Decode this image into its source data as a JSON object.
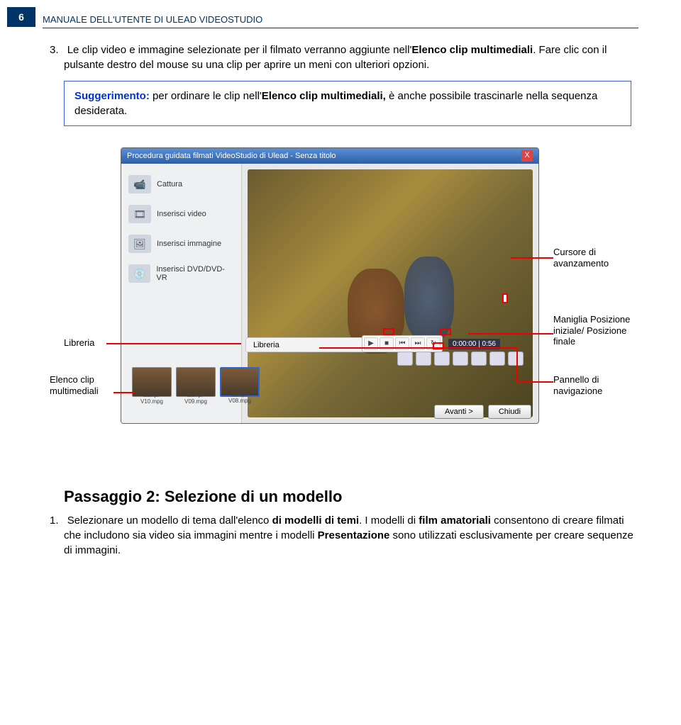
{
  "page_number": "6",
  "header_title": "MANUALE DELL'UTENTE DI ULEAD VIDEOSTUDIO",
  "para3_num": "3.",
  "para3": "Le clip video e immagine selezionate per il filmato verranno aggiunte nell'",
  "para3_bold": "Elenco clip multimediali",
  "para3_tail": ". Fare clic con il pulsante destro del mouse su una clip per aprire un meni con ulteriori opzioni.",
  "tip_label": "Suggerimento:",
  "tip_text": " per ordinare le clip nell'",
  "tip_bold": "Elenco clip multimediali,",
  "tip_tail": " è anche possibile trascinarle nella sequenza desiderata.",
  "window": {
    "title": "Procedura guidata filmati VideoStudio di Ulead - Senza titolo",
    "close": "X",
    "side": {
      "cattura": "Cattura",
      "video": "Inserisci video",
      "immagine": "Inserisci immagine",
      "dvd": "Inserisci DVD/DVD-VR"
    },
    "lib_label": "Libreria",
    "timecode": "0:00:00 | 0:56",
    "thumbs": [
      "Sampl-V10.mpg",
      "Sampl-V09.mpg",
      "Sampl-V08.mpg"
    ],
    "btn_avanti": "Avanti >",
    "btn_chiudi": "Chiudi"
  },
  "callouts": {
    "cursore": "Cursore di avanzamento",
    "libreria": "Libreria",
    "elenco": "Elenco clip multimediali",
    "maniglia": "Maniglia Posizione iniziale/ Posizione finale",
    "pannello": "Pannello di navigazione"
  },
  "section2_title": "Passaggio 2: Selezione di un modello",
  "section2_num": "1.",
  "section2_p1": "Selezionare un modello di tema dall'elenco ",
  "section2_b1": "di modelli di temi",
  "section2_p2": ". I modelli di ",
  "section2_b2": "film amatoriali",
  "section2_p3": " consentono di creare filmati che includono sia video sia immagini mentre i modelli ",
  "section2_b3": "Presentazione",
  "section2_p4": " sono utilizzati esclusivamente per creare sequenze di immagini."
}
